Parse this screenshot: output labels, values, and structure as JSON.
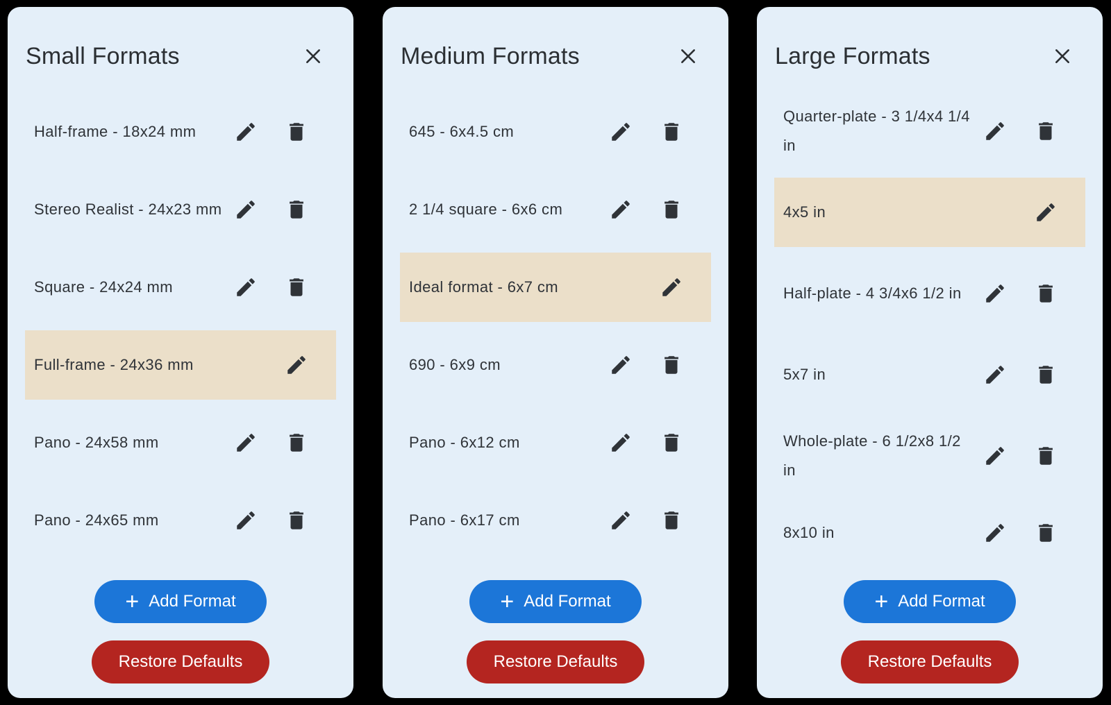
{
  "colors": {
    "background": "#000000",
    "panel": "#e4eff9",
    "selected_row": "#ebdfc9",
    "primary": "#1c76d8",
    "danger": "#b42520",
    "text": "#2f3338"
  },
  "icons": {
    "close": "close-icon",
    "edit": "pencil-icon",
    "delete": "trash-icon",
    "add": "plus-icon"
  },
  "panels": [
    {
      "title": "Small Formats",
      "items": [
        {
          "label": "Half-frame - 18x24 mm",
          "selected": false
        },
        {
          "label": "Stereo Realist - 24x23 mm",
          "selected": false
        },
        {
          "label": "Square - 24x24 mm",
          "selected": false
        },
        {
          "label": "Full-frame - 24x36 mm",
          "selected": true
        },
        {
          "label": "Pano - 24x58 mm",
          "selected": false
        },
        {
          "label": "Pano - 24x65 mm",
          "selected": false
        }
      ],
      "add_label": "Add Format",
      "restore_label": "Restore Defaults"
    },
    {
      "title": "Medium Formats",
      "items": [
        {
          "label": "645 - 6x4.5 cm",
          "selected": false
        },
        {
          "label": "2 1/4 square - 6x6 cm",
          "selected": false
        },
        {
          "label": "Ideal format - 6x7 cm",
          "selected": true
        },
        {
          "label": "690 - 6x9 cm",
          "selected": false
        },
        {
          "label": "Pano - 6x12 cm",
          "selected": false
        },
        {
          "label": "Pano - 6x17 cm",
          "selected": false
        }
      ],
      "add_label": "Add Format",
      "restore_label": "Restore Defaults"
    },
    {
      "title": "Large Formats",
      "items": [
        {
          "label": "Quarter-plate - 3 1/4x4 1/4 in",
          "selected": false
        },
        {
          "label": "4x5 in",
          "selected": true
        },
        {
          "label": "Half-plate - 4 3/4x6 1/2 in",
          "selected": false
        },
        {
          "label": "5x7 in",
          "selected": false
        },
        {
          "label": "Whole-plate - 6 1/2x8 1/2 in",
          "selected": false
        },
        {
          "label": "8x10 in",
          "selected": false
        }
      ],
      "add_label": "Add Format",
      "restore_label": "Restore Defaults"
    }
  ]
}
